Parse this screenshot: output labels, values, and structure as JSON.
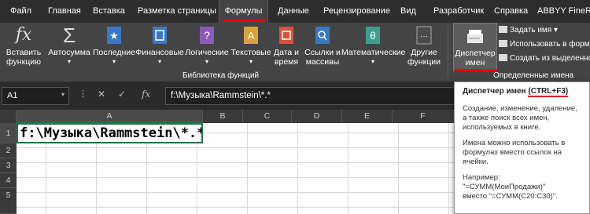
{
  "tabs": [
    "Файл",
    "Главная",
    "Вставка",
    "Разметка страницы",
    "Формулы",
    "Данные",
    "Рецензирование",
    "Вид",
    "Разработчик",
    "Справка",
    "ABBYY FineRe"
  ],
  "ribbon": {
    "insert_function": [
      "Вставить",
      "функцию"
    ],
    "autosum": "Автосумма",
    "recent": "Последние",
    "financial": "Финансовые",
    "logical": "Логические",
    "text": "Текстовые",
    "datetime": [
      "Дата и",
      "время"
    ],
    "lookup": [
      "Ссылки и",
      "массивы"
    ],
    "math": "Математические",
    "other": [
      "Другие",
      "функции"
    ],
    "group_library": "Библиотека функций",
    "name_manager": [
      "Диспетчер",
      "имен"
    ],
    "define_name": "Задать имя",
    "use_in_formula": "Использовать в формулы",
    "create_from_selection": "Создать из выделенно",
    "group_names": "Определенные имена"
  },
  "formula_bar": {
    "name_box": "A1",
    "cancel": "✕",
    "enter": "✓",
    "fx": "fx",
    "value": "f:\\Музыка\\Rammstein\\*.*"
  },
  "columns": [
    "A",
    "B",
    "C",
    "D",
    "E",
    "F"
  ],
  "rows": [
    "1",
    "2",
    "3",
    "4",
    "5"
  ],
  "cell_a1": "f:\\Музыка\\Rammstein\\*.*",
  "tooltip": {
    "title": "Диспетчер имен",
    "shortcut": "(CTRL+F3)",
    "p1": "Создание, изменение, удаление, а также поиск всех имен, используемых в книге.",
    "p2": "Имена можно использовать в формулах вместо ссылок на ячейки.",
    "p3_title": "Например:",
    "p3_line1": "\"=СУММ(МоиПродажи)\"",
    "p3_line2": "вместо \"=СУММ(C20:C30)\"."
  },
  "colors": {
    "accent": "#e00000",
    "grid_select": "#217346"
  }
}
